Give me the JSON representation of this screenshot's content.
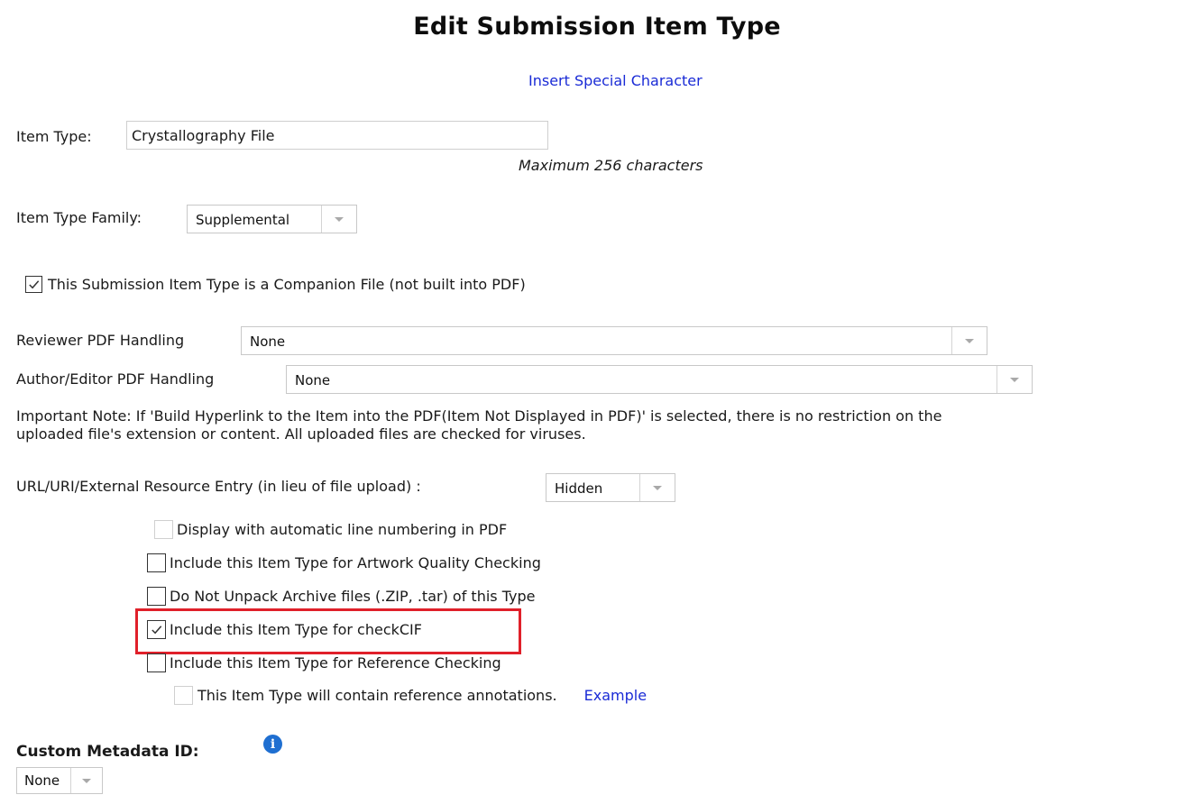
{
  "page_title": "Edit Submission Item Type",
  "insert_special_character": "Insert Special Character",
  "item_type": {
    "label": "Item Type:",
    "value": "Crystallography File",
    "hint": "Maximum 256 characters"
  },
  "item_type_family": {
    "label": "Item Type Family:",
    "selected": "Supplemental"
  },
  "companion_file": {
    "label": "This Submission Item Type is a Companion File (not built into PDF)",
    "checked": true
  },
  "reviewer_pdf": {
    "label": "Reviewer PDF Handling",
    "selected": "None"
  },
  "author_editor_pdf": {
    "label": "Author/Editor PDF Handling",
    "selected": "None"
  },
  "important_note": {
    "line1": "Important Note: If 'Build Hyperlink to the Item into the PDF(Item Not Displayed in PDF)' is selected, there is no restriction on the",
    "line2": "uploaded file's extension or content. All uploaded files are checked for viruses."
  },
  "url_entry": {
    "label": "URL/URI/External Resource Entry (in lieu of file upload) :",
    "selected": "Hidden"
  },
  "options": [
    {
      "label": "Display with automatic line numbering in PDF",
      "checked": false,
      "disabled": true
    },
    {
      "label": "Include this Item Type for Artwork Quality Checking",
      "checked": false,
      "disabled": false
    },
    {
      "label": "Do Not Unpack Archive files (.ZIP, .tar) of this Type",
      "checked": false,
      "disabled": false
    },
    {
      "label": "Include this Item Type for checkCIF",
      "checked": true,
      "disabled": false
    },
    {
      "label": "Include this Item Type for Reference Checking",
      "checked": false,
      "disabled": false
    }
  ],
  "reference_annotations": {
    "label": "This Item Type will contain reference annotations.",
    "link": "Example",
    "checked": false,
    "disabled": true
  },
  "custom_metadata": {
    "label": "Custom Metadata ID:",
    "info_glyph": "i",
    "selected": "None"
  },
  "colors": {
    "link": "#1a2bd6",
    "highlight": "#e0202a",
    "info": "#1f6fd1"
  }
}
